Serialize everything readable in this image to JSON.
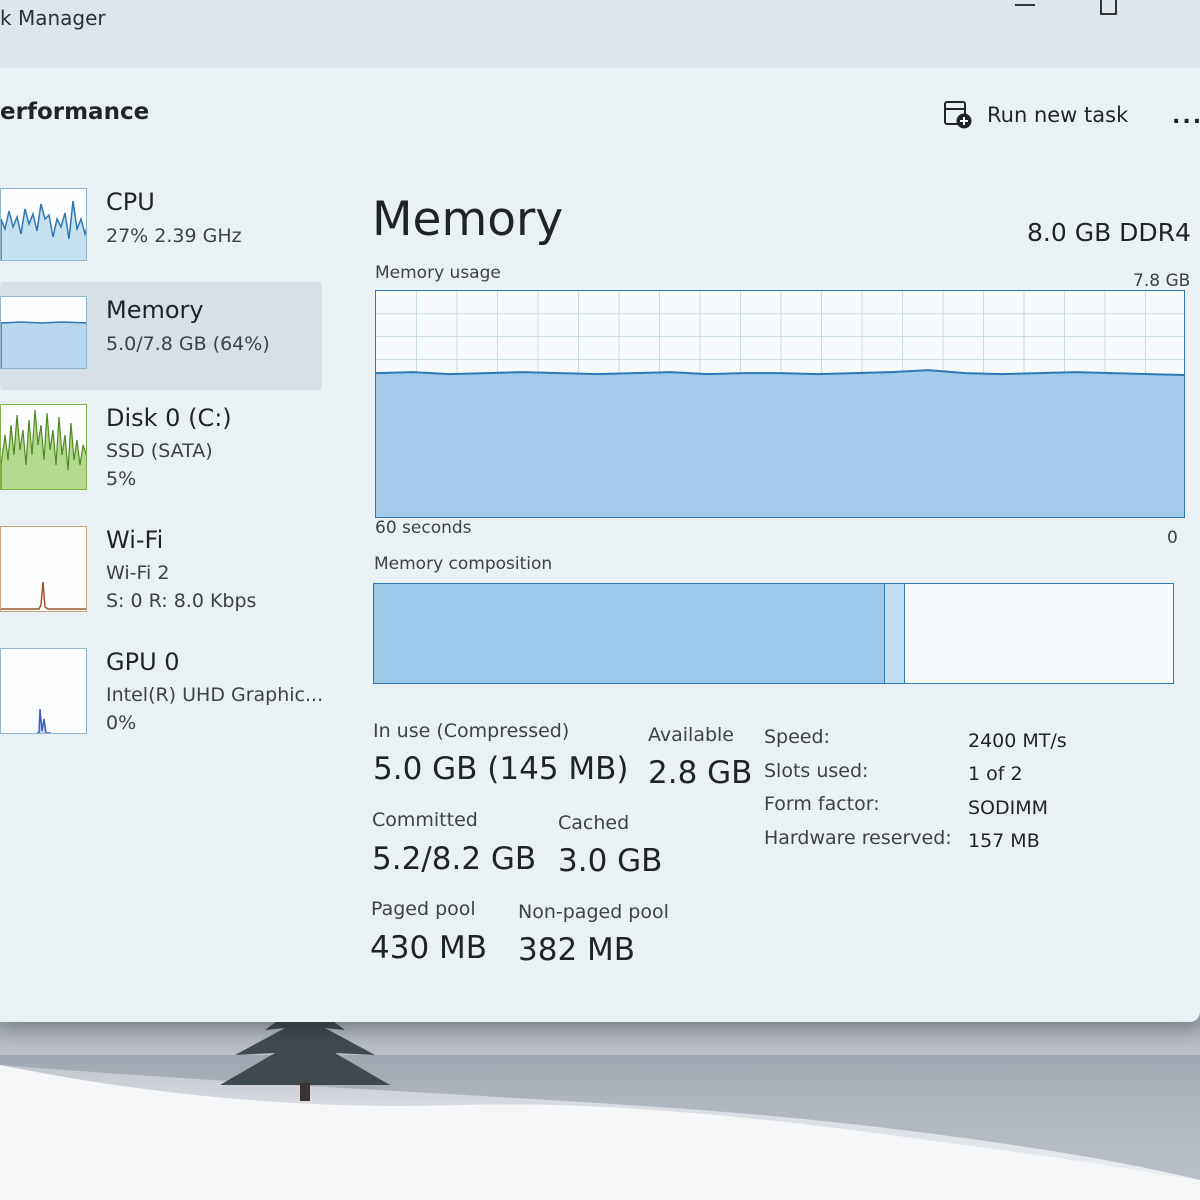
{
  "window": {
    "title": "k Manager"
  },
  "header": {
    "title": "erformance",
    "run_task_label": "Run new task",
    "more_label": "..."
  },
  "sidebar": {
    "items": [
      {
        "name": "CPU",
        "lines": [
          "27%  2.39 GHz"
        ],
        "selected": false
      },
      {
        "name": "Memory",
        "lines": [
          "5.0/7.8 GB (64%)"
        ],
        "selected": true
      },
      {
        "name": "Disk 0 (C:)",
        "lines": [
          "SSD (SATA)",
          "5%"
        ],
        "selected": false
      },
      {
        "name": "Wi-Fi",
        "lines": [
          "Wi-Fi 2",
          "S: 0 R: 8.0 Kbps"
        ],
        "selected": false
      },
      {
        "name": "GPU 0",
        "lines": [
          "Intel(R) UHD Graphic...",
          "0%"
        ],
        "selected": false
      }
    ]
  },
  "main": {
    "title": "Memory",
    "spec": "8.0 GB DDR4",
    "usage_label": "Memory usage",
    "usage_max": "7.8 GB",
    "time_span": "60 seconds",
    "time_end": "0",
    "composition_label": "Memory composition",
    "composition": {
      "in_use_fraction": 0.64,
      "modified_fraction": 0.025
    },
    "usage_fraction": 0.64
  },
  "stats": {
    "in_use_label": "In use (Compressed)",
    "in_use_value": "5.0 GB (145 MB)",
    "available_label": "Available",
    "available_value": "2.8 GB",
    "committed_label": "Committed",
    "committed_value": "5.2/8.2 GB",
    "cached_label": "Cached",
    "cached_value": "3.0 GB",
    "paged_label": "Paged pool",
    "paged_value": "430 MB",
    "nonpaged_label": "Non-paged pool",
    "nonpaged_value": "382 MB"
  },
  "specs": {
    "speed_label": "Speed:",
    "speed_value": "2400 MT/s",
    "slots_label": "Slots used:",
    "slots_value": "1 of 2",
    "form_label": "Form factor:",
    "form_value": "SODIMM",
    "reserved_label": "Hardware reserved:",
    "reserved_value": "157 MB"
  },
  "colors": {
    "accent": "#2f77b5",
    "fill": "#9ec8ea",
    "graph_bg": "#f7fbfd"
  },
  "icons": {
    "run_task": "run-task-icon",
    "more": "more-icon"
  }
}
